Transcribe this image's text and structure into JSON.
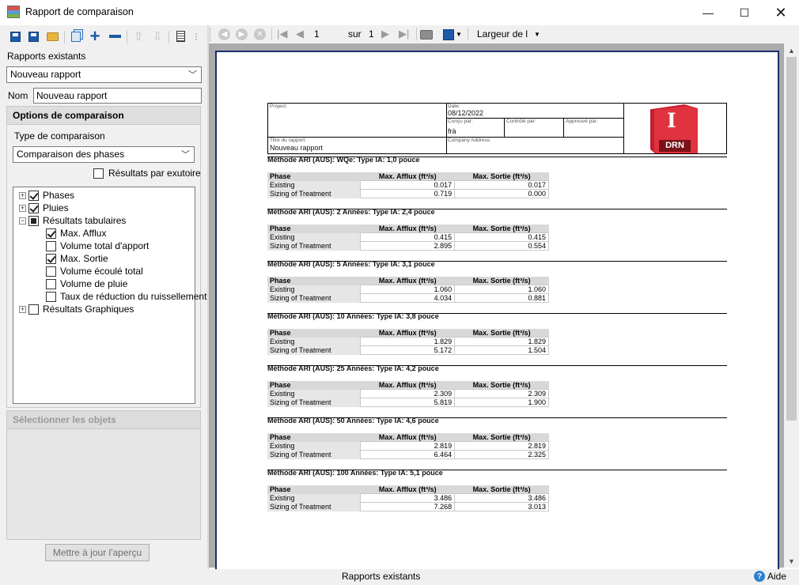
{
  "window": {
    "title": "Rapport de comparaison",
    "min_glyph": "—",
    "max_glyph": "☐",
    "close_glyph": "✕"
  },
  "left": {
    "existing_reports_label": "Rapports existants",
    "existing_reports_value": "Nouveau rapport",
    "name_label": "Nom",
    "name_value": "Nouveau rapport",
    "options_header": "Options de comparaison",
    "comparison_type_label": "Type de comparaison",
    "comparison_type_value": "Comparaison des phases",
    "results_by_outfall_label": "Résultats par exutoire",
    "tree": [
      {
        "label": "Phases",
        "state": "checked",
        "expander": "+"
      },
      {
        "label": "Pluies",
        "state": "checked",
        "expander": "+"
      },
      {
        "label": "Résultats tabulaires",
        "state": "partial",
        "expander": "−"
      },
      {
        "label": "Max. Afflux",
        "state": "checked"
      },
      {
        "label": "Volume total d'apport",
        "state": "unchecked"
      },
      {
        "label": "Max. Sortie",
        "state": "checked"
      },
      {
        "label": "Volume écoulé total",
        "state": "unchecked"
      },
      {
        "label": "Volume de pluie",
        "state": "unchecked"
      },
      {
        "label": "Taux de réduction du ruissellement",
        "state": "unchecked"
      },
      {
        "label": "Résultats Graphiques",
        "state": "unchecked",
        "expander": "+"
      }
    ],
    "select_objects_header": "Sélectionner les objets",
    "update_preview_button": "Mettre à jour l'aperçu"
  },
  "viewer_toolbar": {
    "page_current": "1",
    "page_of": "sur",
    "page_total": "1",
    "zoom_mode": "Largeur de l"
  },
  "report": {
    "header": {
      "project_label": "Project:",
      "project_value": "",
      "date_label": "Date:",
      "date_value": "08/12/2022",
      "designed_by_label": "Conçu par:",
      "designed_by_value": "frà",
      "checked_by_label": "Contrôlé par:",
      "approved_by_label": "Approuvé par:",
      "report_title_label": "Titre du rapport:",
      "report_title_value": "Nouveau rapport",
      "company_address_label": "Company Address:",
      "logo_letter": "I",
      "logo_text": "DRN"
    },
    "columns": [
      "Phase",
      "Max. Afflux (ft³/s)",
      "Max. Sortie (ft³/s)"
    ],
    "sections": [
      {
        "title": "Méthode ARI (AUS): WQe: Type IA: 1,0 pouce",
        "rows": [
          [
            "Existing",
            "0.017",
            "0.017"
          ],
          [
            "Sizing of Treatment",
            "0.719",
            "0.000"
          ]
        ]
      },
      {
        "title": "Méthode ARI (AUS): 2 Années: Type IA: 2,4 pouce",
        "rows": [
          [
            "Existing",
            "0.415",
            "0.415"
          ],
          [
            "Sizing of Treatment",
            "2.895",
            "0.554"
          ]
        ]
      },
      {
        "title": "Méthode ARI (AUS): 5 Années: Type IA: 3,1 pouce",
        "rows": [
          [
            "Existing",
            "1.060",
            "1.060"
          ],
          [
            "Sizing of Treatment",
            "4.034",
            "0.881"
          ]
        ]
      },
      {
        "title": "Méthode ARI (AUS): 10 Années: Type IA: 3,8 pouce",
        "rows": [
          [
            "Existing",
            "1.829",
            "1.829"
          ],
          [
            "Sizing of Treatment",
            "5.172",
            "1.504"
          ]
        ]
      },
      {
        "title": "Méthode ARI (AUS): 25 Années: Type IA: 4,2 pouce",
        "rows": [
          [
            "Existing",
            "2.309",
            "2.309"
          ],
          [
            "Sizing of Treatment",
            "5.819",
            "1.900"
          ]
        ]
      },
      {
        "title": "Méthode ARI (AUS): 50 Années: Type IA: 4,6 pouce",
        "rows": [
          [
            "Existing",
            "2.819",
            "2.819"
          ],
          [
            "Sizing of Treatment",
            "6.464",
            "2.325"
          ]
        ]
      },
      {
        "title": "Méthode ARI (AUS): 100 Années: Type IA: 5,1 pouce",
        "rows": [
          [
            "Existing",
            "3.486",
            "3.486"
          ],
          [
            "Sizing of Treatment",
            "7.268",
            "3.013"
          ]
        ]
      }
    ]
  },
  "status_bar": {
    "center_text": "Rapports existants",
    "help_label": "Aide"
  }
}
